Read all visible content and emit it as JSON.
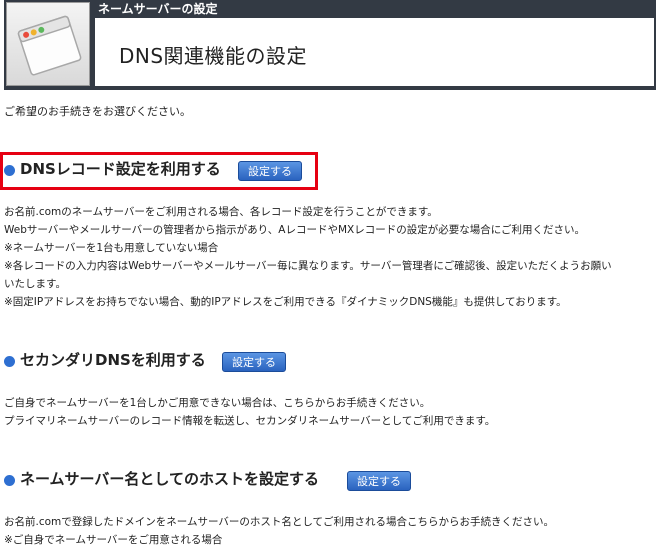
{
  "header": {
    "subtitle": "ネームサーバーの設定",
    "title": "DNS関連機能の設定"
  },
  "intro": "ご希望のお手続きをお選びください。",
  "sections": [
    {
      "title": "DNSレコード設定を利用する",
      "button": "設定する",
      "lines": [
        "お名前.comのネームサーバーをご利用される場合、各レコード設定を行うことができます。",
        "Webサーバーやメールサーバーの管理者から指示があり、AレコードやMXレコードの設定が必要な場合にご利用ください。",
        "※ネームサーバーを1台も用意していない場合",
        "※各レコードの入力内容はWebサーバーやメールサーバー毎に異なります。サーバー管理者にご確認後、設定いただくようお願い",
        "いたします。",
        "※固定IPアドレスをお持ちでない場合、動的IPアドレスをご利用できる『ダイナミックDNS機能』も提供しております。"
      ]
    },
    {
      "title": "セカンダリDNSを利用する",
      "button": "設定する",
      "lines": [
        "ご自身でネームサーバーを1台しかご用意できない場合は、こちらからお手続きください。",
        "プライマリネームサーバーのレコード情報を転送し、セカンダリネームサーバーとしてご利用できます。"
      ]
    },
    {
      "title": "ネームサーバー名としてのホストを設定する",
      "button": "設定する",
      "lines": [
        "お名前.comで登録したドメインをネームサーバーのホスト名としてご利用される場合こちらからお手続きください。",
        "※ご自身でネームサーバーをご用意される場合"
      ]
    }
  ],
  "colors": {
    "header_bg": "#333a44",
    "bullet": "#2e6fd1",
    "button": "#2a63bf",
    "highlight": "#e60012"
  }
}
